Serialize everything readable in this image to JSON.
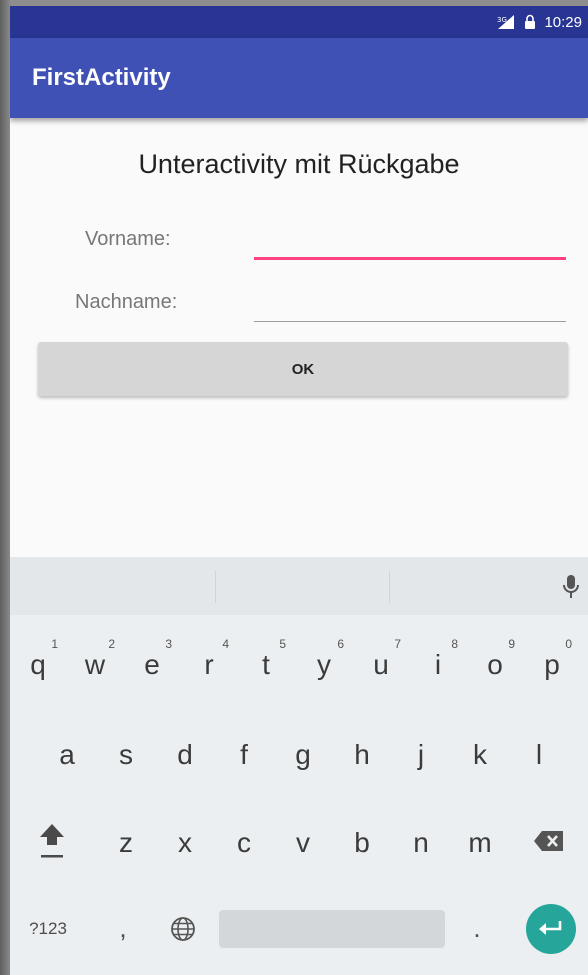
{
  "status_bar": {
    "network": "3G",
    "time": "10:29"
  },
  "app_bar": {
    "title": "FirstActivity"
  },
  "form": {
    "title": "Unteractivity mit Rückgabe",
    "vorname_label": "Vorname:",
    "vorname_value": "",
    "nachname_label": "Nachname:",
    "nachname_value": "",
    "ok_label": "OK"
  },
  "keyboard": {
    "row1": [
      {
        "letter": "q",
        "hint": "1"
      },
      {
        "letter": "w",
        "hint": "2"
      },
      {
        "letter": "e",
        "hint": "3"
      },
      {
        "letter": "r",
        "hint": "4"
      },
      {
        "letter": "t",
        "hint": "5"
      },
      {
        "letter": "y",
        "hint": "6"
      },
      {
        "letter": "u",
        "hint": "7"
      },
      {
        "letter": "i",
        "hint": "8"
      },
      {
        "letter": "o",
        "hint": "9"
      },
      {
        "letter": "p",
        "hint": "0"
      }
    ],
    "row2": [
      "a",
      "s",
      "d",
      "f",
      "g",
      "h",
      "j",
      "k",
      "l"
    ],
    "row3": [
      "z",
      "x",
      "c",
      "v",
      "b",
      "n",
      "m"
    ],
    "symbols_label": "?123",
    "comma": ",",
    "period": ".",
    "icons": {
      "mic": "microphone-icon",
      "shift": "shift-icon",
      "backspace": "backspace-icon",
      "language": "globe-icon",
      "enter": "enter-icon"
    }
  },
  "colors": {
    "status_bar": "#283593",
    "app_bar": "#3f51b5",
    "accent": "#ff4081",
    "enter_key": "#26a69a"
  }
}
